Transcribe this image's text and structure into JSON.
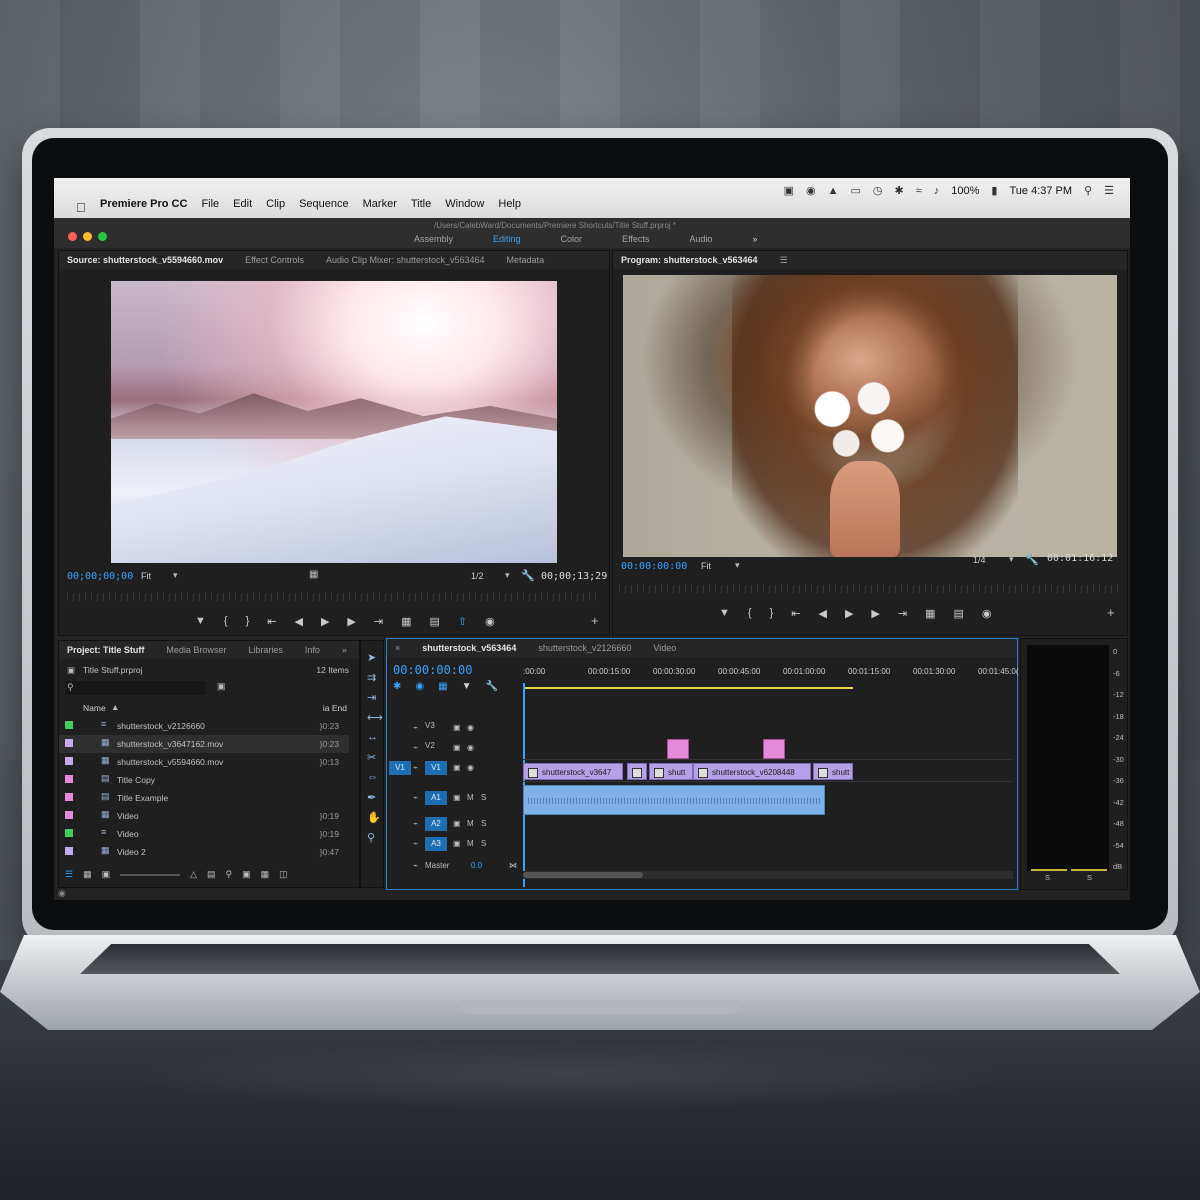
{
  "menubar": {
    "app_name": "Premiere Pro CC",
    "menus": [
      "File",
      "Edit",
      "Clip",
      "Sequence",
      "Marker",
      "Title",
      "Window",
      "Help"
    ],
    "battery": "100%",
    "clock": "Tue 4:37 PM"
  },
  "apphead": {
    "file_path": "/Users/CalebWard/Documents/Premiere Shortcuts/Title Stuff.prproj *",
    "workspaces": [
      "Assembly",
      "Editing",
      "Color",
      "Effects",
      "Audio"
    ],
    "active_workspace": "Editing",
    "more": "»"
  },
  "source_panel": {
    "tabs": [
      "Source: shutterstock_v5594660.mov",
      "Effect Controls",
      "Audio Clip Mixer: shutterstock_v563464",
      "Metadata"
    ],
    "timecode_in": "00;00;00;00",
    "fit": "Fit",
    "resolution": "1/2",
    "duration": "00;00;13;29"
  },
  "program_panel": {
    "title": "Program: shutterstock_v563464",
    "timecode_in": "00:00:00:00",
    "fit": "Fit",
    "resolution": "1/4",
    "duration": "00:01:16:12"
  },
  "project_panel": {
    "tabs": [
      "Project: Title Stuff",
      "Media Browser",
      "Libraries",
      "Info"
    ],
    "more": "»",
    "project_file": "Title Stuff.prproj",
    "item_count": "12 Items",
    "col_name": "Name",
    "col_end": "ia End",
    "items": [
      {
        "name": "shutterstock_v2126660",
        "dur": "}0:23",
        "color": "#3fcf5a",
        "icon": "sequence"
      },
      {
        "name": "shutterstock_v3647162.mov",
        "dur": "}0:23",
        "color": "#c7a9ee",
        "icon": "film"
      },
      {
        "name": "shutterstock_v5594660.mov",
        "dur": "}0:13",
        "color": "#c7a9ee",
        "icon": "film"
      },
      {
        "name": "Title Copy",
        "dur": "",
        "color": "#e589db",
        "icon": "title"
      },
      {
        "name": "Title Example",
        "dur": "",
        "color": "#e589db",
        "icon": "title"
      },
      {
        "name": "Video",
        "dur": "}0:19",
        "color": "#e589db",
        "icon": "film"
      },
      {
        "name": "Video",
        "dur": "}0:19",
        "color": "#3fcf5a",
        "icon": "sequence"
      },
      {
        "name": "Video 2",
        "dur": "}0:47",
        "color": "#c7a9ee",
        "icon": "film"
      }
    ]
  },
  "timeline": {
    "tabs": [
      "shutterstock_v563464",
      "shutterstock_v2126660",
      "Video"
    ],
    "close": "×",
    "playhead": "00:00:00:00",
    "ruler": [
      ":00:00",
      "00:00:15:00",
      "00:00:30:00",
      "00:00:45:00",
      "00:01:00:00",
      "00:01:15:00",
      "00:01:30:00",
      "00:01:45:0("
    ],
    "video_tracks": [
      "V3",
      "V2",
      "V1"
    ],
    "audio_tracks": [
      "A1",
      "A2",
      "A3"
    ],
    "source_v": "V1",
    "mute": "M",
    "solo": "S",
    "master_label": "Master",
    "master_value": "0.0",
    "clips_v1": [
      "shutterstock_v3647",
      "shutt",
      "shutterstock_v6208448",
      "shutt"
    ]
  },
  "audio_meter": {
    "scale": [
      "0",
      "-6",
      "-12",
      "-18",
      "-24",
      "-30",
      "-36",
      "-42",
      "-48",
      "-54",
      "dB"
    ],
    "solo": [
      "S",
      "S"
    ]
  }
}
